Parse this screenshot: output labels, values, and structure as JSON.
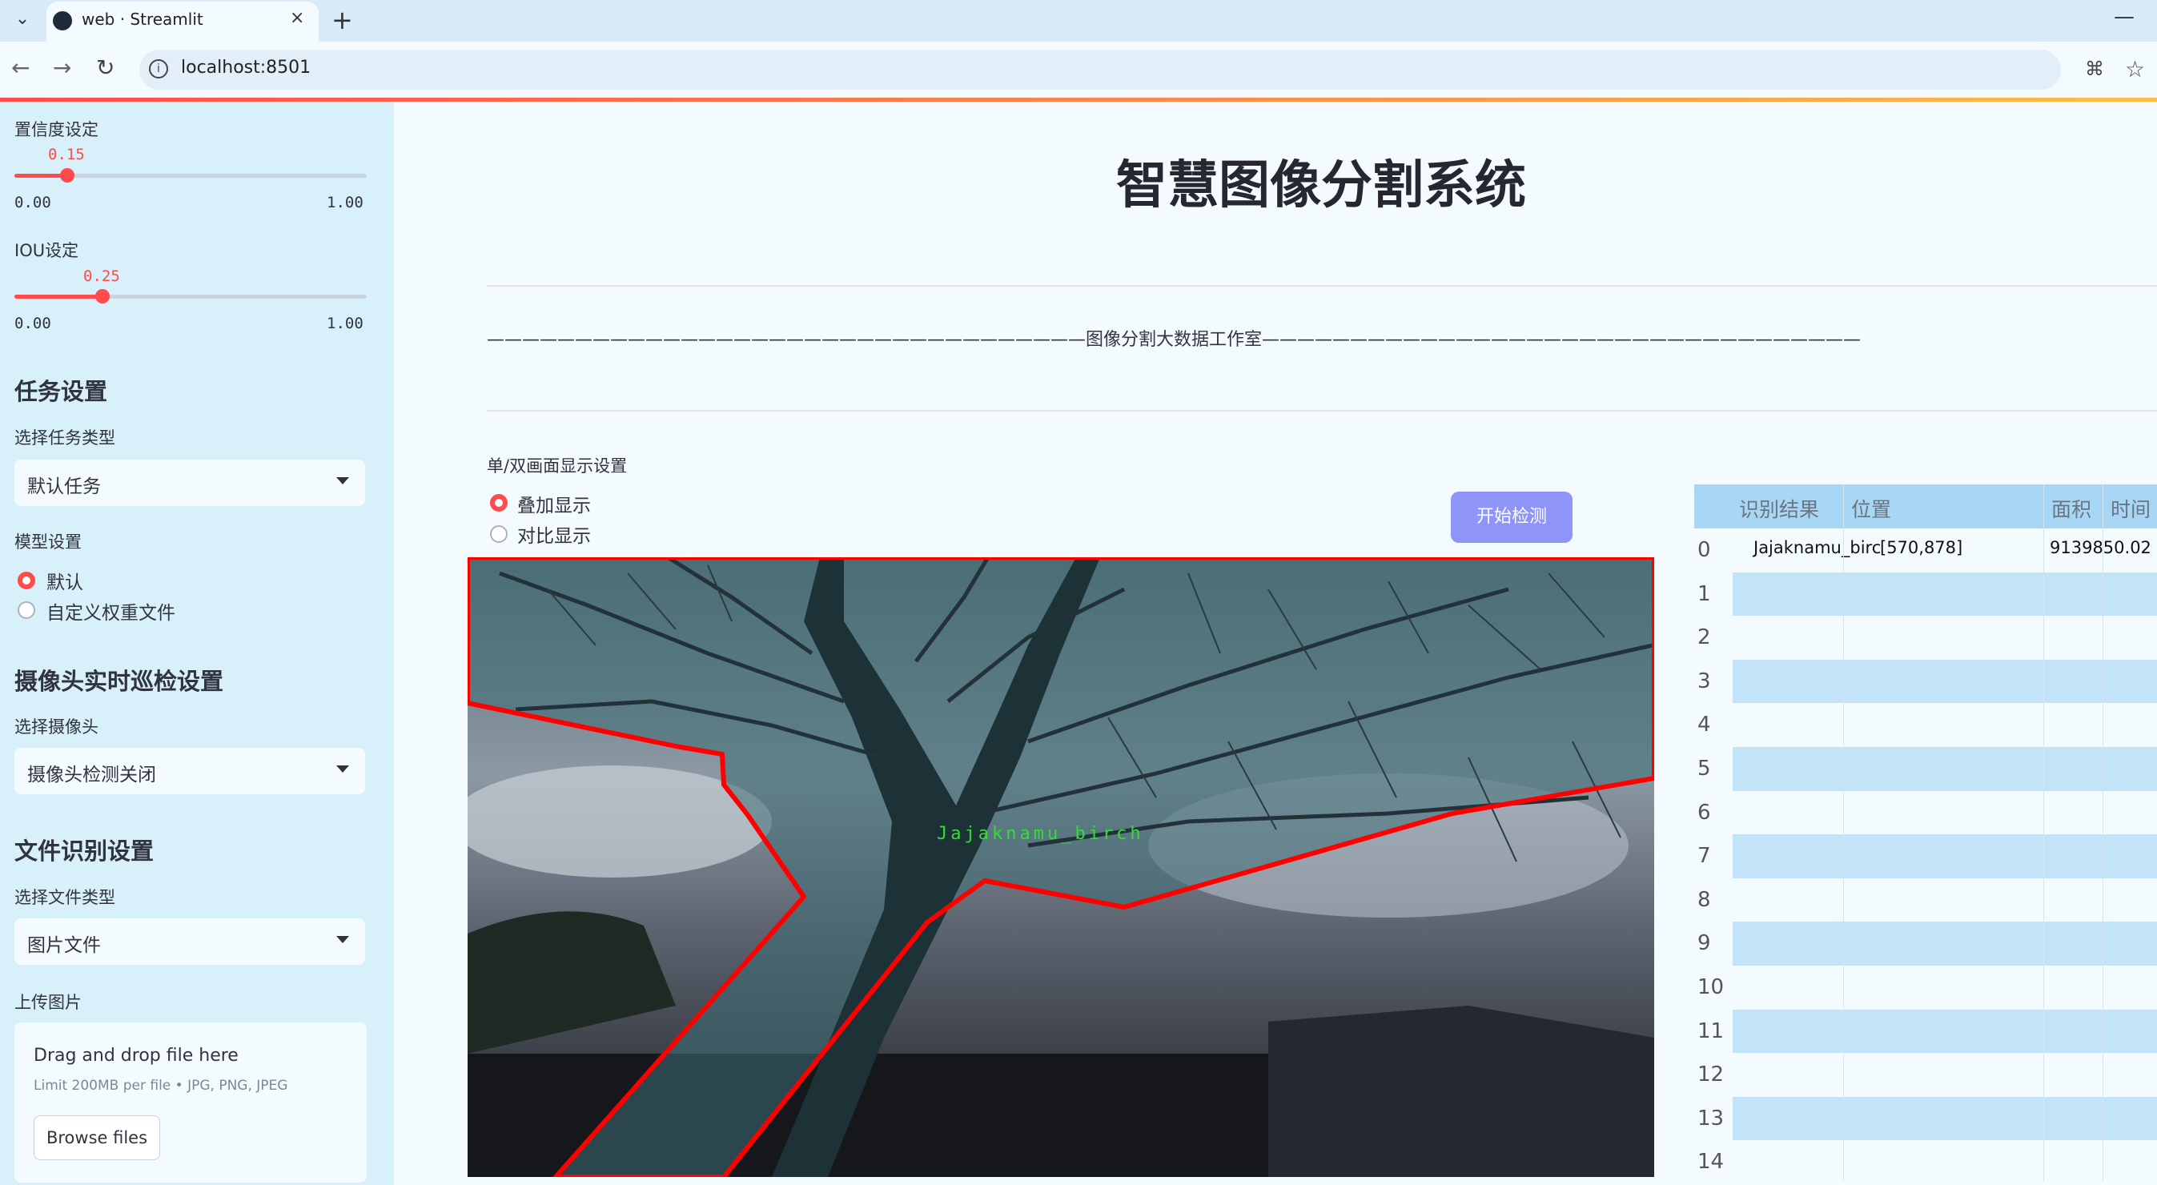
{
  "browser": {
    "tab_title": "web · Streamlit",
    "close_glyph": "×",
    "new_tab_glyph": "+",
    "url": "localhost:8501"
  },
  "sidebar": {
    "confidence": {
      "label": "置信度设定",
      "value": "0.15",
      "min": "0.00",
      "max": "1.00",
      "fraction": 0.15
    },
    "iou": {
      "label": "IOU设定",
      "value": "0.25",
      "min": "0.00",
      "max": "1.00",
      "fraction": 0.25
    },
    "task_section": "任务设置",
    "task_type_label": "选择任务类型",
    "task_type_value": "默认任务",
    "model_label": "模型设置",
    "model_options": [
      "默认",
      "自定义权重文件"
    ],
    "model_selected": 0,
    "camera_section": "摄像头实时巡检设置",
    "camera_label": "选择摄像头",
    "camera_value": "摄像头检测关闭",
    "file_section": "文件识别设置",
    "file_type_label": "选择文件类型",
    "file_type_value": "图片文件",
    "upload_label": "上传图片",
    "upload_drop": "Drag and drop file here",
    "upload_limit": "Limit 200MB per file • JPG, PNG, JPEG",
    "browse_label": "Browse files"
  },
  "main": {
    "title": "智慧图像分割系统",
    "subtitle": "——————————————————————————————————图像分割大数据工作室——————————————————————————————————",
    "display_label": "单/双画面显示设置",
    "display_options": [
      "叠加显示",
      "对比显示"
    ],
    "display_selected": 0,
    "start_button": "开始检测",
    "detection_label": "Jajaknamu_birch"
  },
  "table": {
    "headers": [
      "识别结果",
      "位置",
      "面积",
      "时间"
    ],
    "rows": [
      {
        "index": "0",
        "result": "Jajaknamu_birch",
        "position": "[570,878]",
        "area": "9139850.02"
      },
      {
        "index": "1"
      },
      {
        "index": "2"
      },
      {
        "index": "3"
      },
      {
        "index": "4"
      },
      {
        "index": "5"
      },
      {
        "index": "6"
      },
      {
        "index": "7"
      },
      {
        "index": "8"
      },
      {
        "index": "9"
      },
      {
        "index": "10"
      },
      {
        "index": "11"
      },
      {
        "index": "12"
      },
      {
        "index": "13"
      },
      {
        "index": "14"
      }
    ]
  },
  "colors": {
    "accent": "#ff4b4b",
    "button": "#8f94f9",
    "sidebar": "#d8f0fa",
    "table_header": "#a8d6f5",
    "table_stripe": "#c2e3f8",
    "polygon": "#ff0000",
    "label": "#33dd33"
  }
}
